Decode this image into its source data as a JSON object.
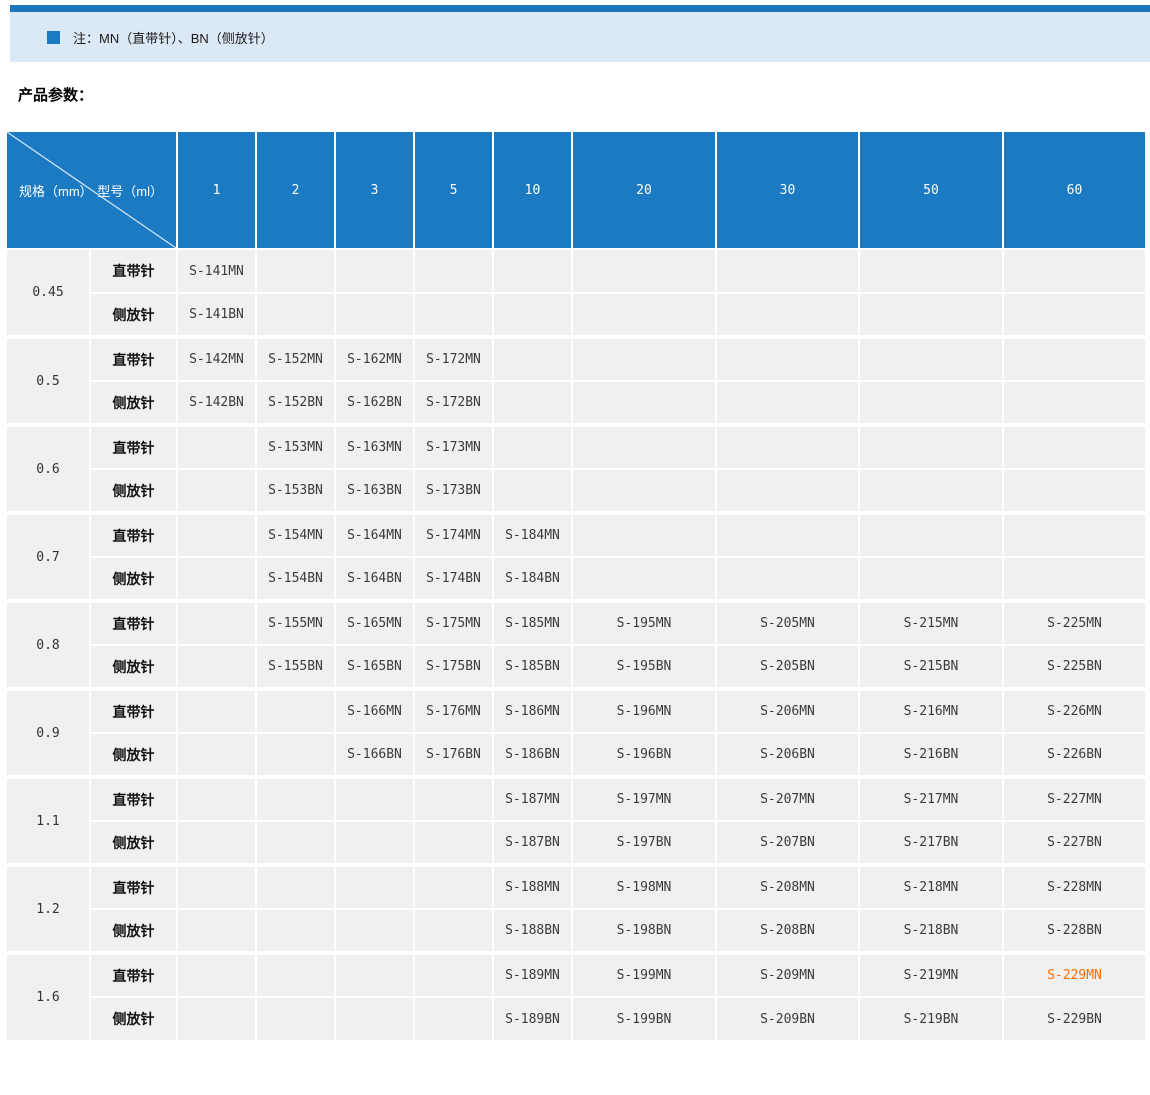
{
  "note": {
    "text": "注：MN（直带针）、BN（侧放针）"
  },
  "section_title": "产品参数：",
  "colors": {
    "top_bar": "#1c76bd",
    "note_background": "#dbe8f5",
    "note_bullet": "#1b7ac2",
    "table_header": "#1b7ac2",
    "cell_background": "#f0f0f0",
    "highlight_orange": "#ff6c00"
  },
  "table": {
    "corner": {
      "left": "规格（mm）",
      "right": "型号（ml）"
    },
    "columns": [
      "1",
      "2",
      "3",
      "5",
      "10",
      "20",
      "30",
      "50",
      "60"
    ],
    "groups": [
      {
        "spec": "0.45",
        "rows": [
          {
            "type": "直带针",
            "cells": [
              "S-141MN",
              "",
              "",
              "",
              "",
              "",
              "",
              "",
              ""
            ]
          },
          {
            "type": "侧放针",
            "cells": [
              "S-141BN",
              "",
              "",
              "",
              "",
              "",
              "",
              "",
              ""
            ]
          }
        ]
      },
      {
        "spec": "0.5",
        "rows": [
          {
            "type": "直带针",
            "cells": [
              "S-142MN",
              "S-152MN",
              "S-162MN",
              "S-172MN",
              "",
              "",
              "",
              "",
              ""
            ]
          },
          {
            "type": "侧放针",
            "cells": [
              "S-142BN",
              "S-152BN",
              "S-162BN",
              "S-172BN",
              "",
              "",
              "",
              "",
              ""
            ]
          }
        ]
      },
      {
        "spec": "0.6",
        "rows": [
          {
            "type": "直带针",
            "cells": [
              "",
              "S-153MN",
              "S-163MN",
              "S-173MN",
              "",
              "",
              "",
              "",
              ""
            ]
          },
          {
            "type": "侧放针",
            "cells": [
              "",
              "S-153BN",
              "S-163BN",
              "S-173BN",
              "",
              "",
              "",
              "",
              ""
            ]
          }
        ]
      },
      {
        "spec": "0.7",
        "rows": [
          {
            "type": "直带针",
            "cells": [
              "",
              "S-154MN",
              "S-164MN",
              "S-174MN",
              "S-184MN",
              "",
              "",
              "",
              ""
            ]
          },
          {
            "type": "侧放针",
            "cells": [
              "",
              "S-154BN",
              "S-164BN",
              "S-174BN",
              "S-184BN",
              "",
              "",
              "",
              ""
            ]
          }
        ]
      },
      {
        "spec": "0.8",
        "rows": [
          {
            "type": "直带针",
            "cells": [
              "",
              "S-155MN",
              "S-165MN",
              "S-175MN",
              "S-185MN",
              "S-195MN",
              "S-205MN",
              "S-215MN",
              "S-225MN"
            ]
          },
          {
            "type": "侧放针",
            "cells": [
              "",
              "S-155BN",
              "S-165BN",
              "S-175BN",
              "S-185BN",
              "S-195BN",
              "S-205BN",
              "S-215BN",
              "S-225BN"
            ]
          }
        ]
      },
      {
        "spec": "0.9",
        "rows": [
          {
            "type": "直带针",
            "cells": [
              "",
              "",
              "S-166MN",
              "S-176MN",
              "S-186MN",
              "S-196MN",
              "S-206MN",
              "S-216MN",
              "S-226MN"
            ]
          },
          {
            "type": "侧放针",
            "cells": [
              "",
              "",
              "S-166BN",
              "S-176BN",
              "S-186BN",
              "S-196BN",
              "S-206BN",
              "S-216BN",
              "S-226BN"
            ]
          }
        ]
      },
      {
        "spec": "1.1",
        "rows": [
          {
            "type": "直带针",
            "cells": [
              "",
              "",
              "",
              "",
              "S-187MN",
              "S-197MN",
              "S-207MN",
              "S-217MN",
              "S-227MN"
            ]
          },
          {
            "type": "侧放针",
            "cells": [
              "",
              "",
              "",
              "",
              "S-187BN",
              "S-197BN",
              "S-207BN",
              "S-217BN",
              "S-227BN"
            ]
          }
        ]
      },
      {
        "spec": "1.2",
        "rows": [
          {
            "type": "直带针",
            "cells": [
              "",
              "",
              "",
              "",
              "S-188MN",
              "S-198MN",
              "S-208MN",
              "S-218MN",
              "S-228MN"
            ]
          },
          {
            "type": "侧放针",
            "cells": [
              "",
              "",
              "",
              "",
              "S-188BN",
              "S-198BN",
              "S-208BN",
              "S-218BN",
              "S-228BN"
            ]
          }
        ]
      },
      {
        "spec": "1.6",
        "rows": [
          {
            "type": "直带针",
            "cells": [
              "",
              "",
              "",
              "",
              "S-189MN",
              "S-199MN",
              "S-209MN",
              "S-219MN",
              "S-229MN"
            ]
          },
          {
            "type": "侧放针",
            "cells": [
              "",
              "",
              "",
              "",
              "S-189BN",
              "S-199BN",
              "S-209BN",
              "S-219BN",
              "S-229BN"
            ]
          }
        ]
      }
    ],
    "highlight": {
      "group": 8,
      "row": 0,
      "col": 8,
      "color": "#ff6c00"
    }
  }
}
